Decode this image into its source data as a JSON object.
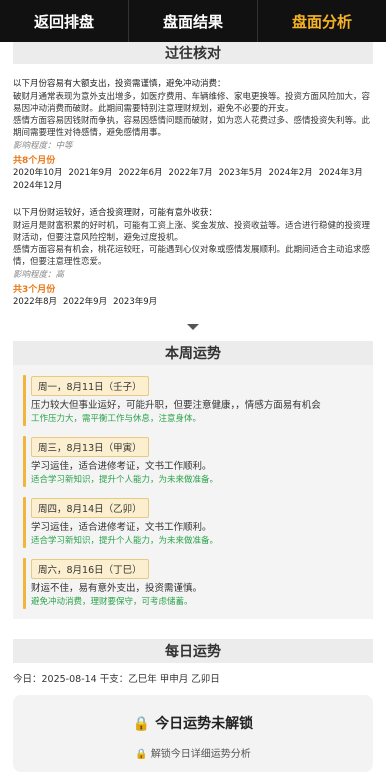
{
  "tabs": [
    {
      "label": "返回排盘",
      "active": false
    },
    {
      "label": "盘面结果",
      "active": false
    },
    {
      "label": "盘面分析",
      "active": true
    }
  ],
  "past": {
    "title": "过往核对",
    "blocks": [
      {
        "head": "以下月份容易有大额支出，投资需谨慎，避免冲动消费：",
        "para1": "破财月通常表现为意外支出增多，如医疗费用、车辆维修、家电更换等。投资方面风险加大，容易因冲动消费而破财。此期间需要特别注意理财规划，避免不必要的开支。",
        "para2": "感情方面容易因钱财而争执，容易因感情问题而破财，如为恋人花费过多、感情投资失利等。此期间需要理性对待感情，避免感情用事。",
        "impact": "影响程度：中等",
        "count": "共8个月份",
        "months": [
          "2020年10月",
          "2021年9月",
          "2022年6月",
          "2022年7月",
          "2023年5月",
          "2024年2月",
          "2024年3月",
          "2024年12月"
        ]
      },
      {
        "head": "以下月份财运较好，适合投资理财，可能有意外收获：",
        "para1": "财运月是财富积累的好时机，可能有工资上涨、奖金发放、投资收益等。适合进行稳健的投资理财活动，但要注意风险控制，避免过度投机。",
        "para2": "感情方面容易有机会，桃花运较旺，可能遇到心仪对象或感情发展顺利。此期间适合主动追求感情，但要注意理性恋爱。",
        "impact": "影响程度：高",
        "count": "共3个月份",
        "months": [
          "2022年8月",
          "2022年9月",
          "2023年9月"
        ]
      }
    ]
  },
  "week": {
    "title": "本周运势",
    "days": [
      {
        "badge": "周一，8月11日（壬子）",
        "text": "压力较大但事业运好，可能升职，但要注意健康，，情感方面易有机会",
        "tip": "工作压力大，需平衡工作与休息，注意身体。"
      },
      {
        "badge": "周三，8月13日（甲寅）",
        "text": "学习运佳，适合进修考证，文书工作顺利。",
        "tip": "适合学习新知识，提升个人能力，为未来做准备。"
      },
      {
        "badge": "周四，8月14日（乙卯）",
        "text": "学习运佳，适合进修考证，文书工作顺利。",
        "tip": "适合学习新知识，提升个人能力，为未来做准备。"
      },
      {
        "badge": "周六，8月16日（丁巳）",
        "text": "财运不佳，易有意外支出，投资需谨慎。",
        "tip": "避免冲动消费，理财要保守，可考虑储蓄。"
      }
    ]
  },
  "daily": {
    "title": "每日运势",
    "today": "今日：2025-08-14  干支：乙巳年 甲申月 乙卯日",
    "lock_icon": "lock-icon",
    "lock_title": "今日运势未解锁",
    "lock_sub": "解锁今日详细运势分析"
  },
  "colors": {
    "accent": "#f5b325",
    "orange": "#e87a1b",
    "green": "#2aa34b",
    "nav": "#111111"
  }
}
